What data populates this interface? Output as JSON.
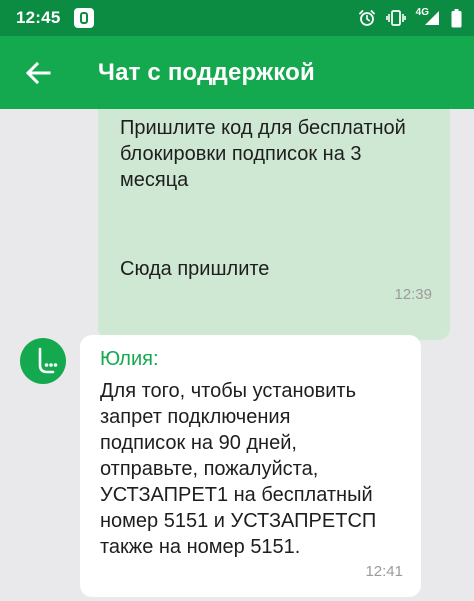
{
  "status_bar": {
    "time": "12:45",
    "network": "4G",
    "icons": [
      "app-icon",
      "alarm-icon",
      "vibrate-icon",
      "signal-icon",
      "battery-icon"
    ]
  },
  "app_bar": {
    "title": "Чат с поддержкой",
    "back_icon": "arrow-left-icon"
  },
  "colors": {
    "status_bar": "#0b8c42",
    "app_bar": "#14a94e",
    "outgoing_bubble": "#cfe8d3",
    "incoming_bubble": "#ffffff",
    "background": "#e9e9ec",
    "sender_name": "#14a94e"
  },
  "messages": [
    {
      "direction": "outgoing",
      "text": "Пришлите код для бесплатной\nблокировки подписок на 3\nмесяца",
      "time": "12:39"
    },
    {
      "direction": "outgoing",
      "text": "Сюда пришлите",
      "time": "12:39"
    },
    {
      "direction": "incoming",
      "sender": "Юлия:",
      "avatar_icon": "megafon-logo-icon",
      "text": "Для того, чтобы установить\nзапрет подключения\nподписок на 90 дней,\nотправьте, пожалуйста,\nУСТЗАПРЕТ1 на бесплатный\nномер 5151 и УСТЗАПРЕТСП\nтакже на номер 5151.",
      "time": "12:41"
    }
  ]
}
